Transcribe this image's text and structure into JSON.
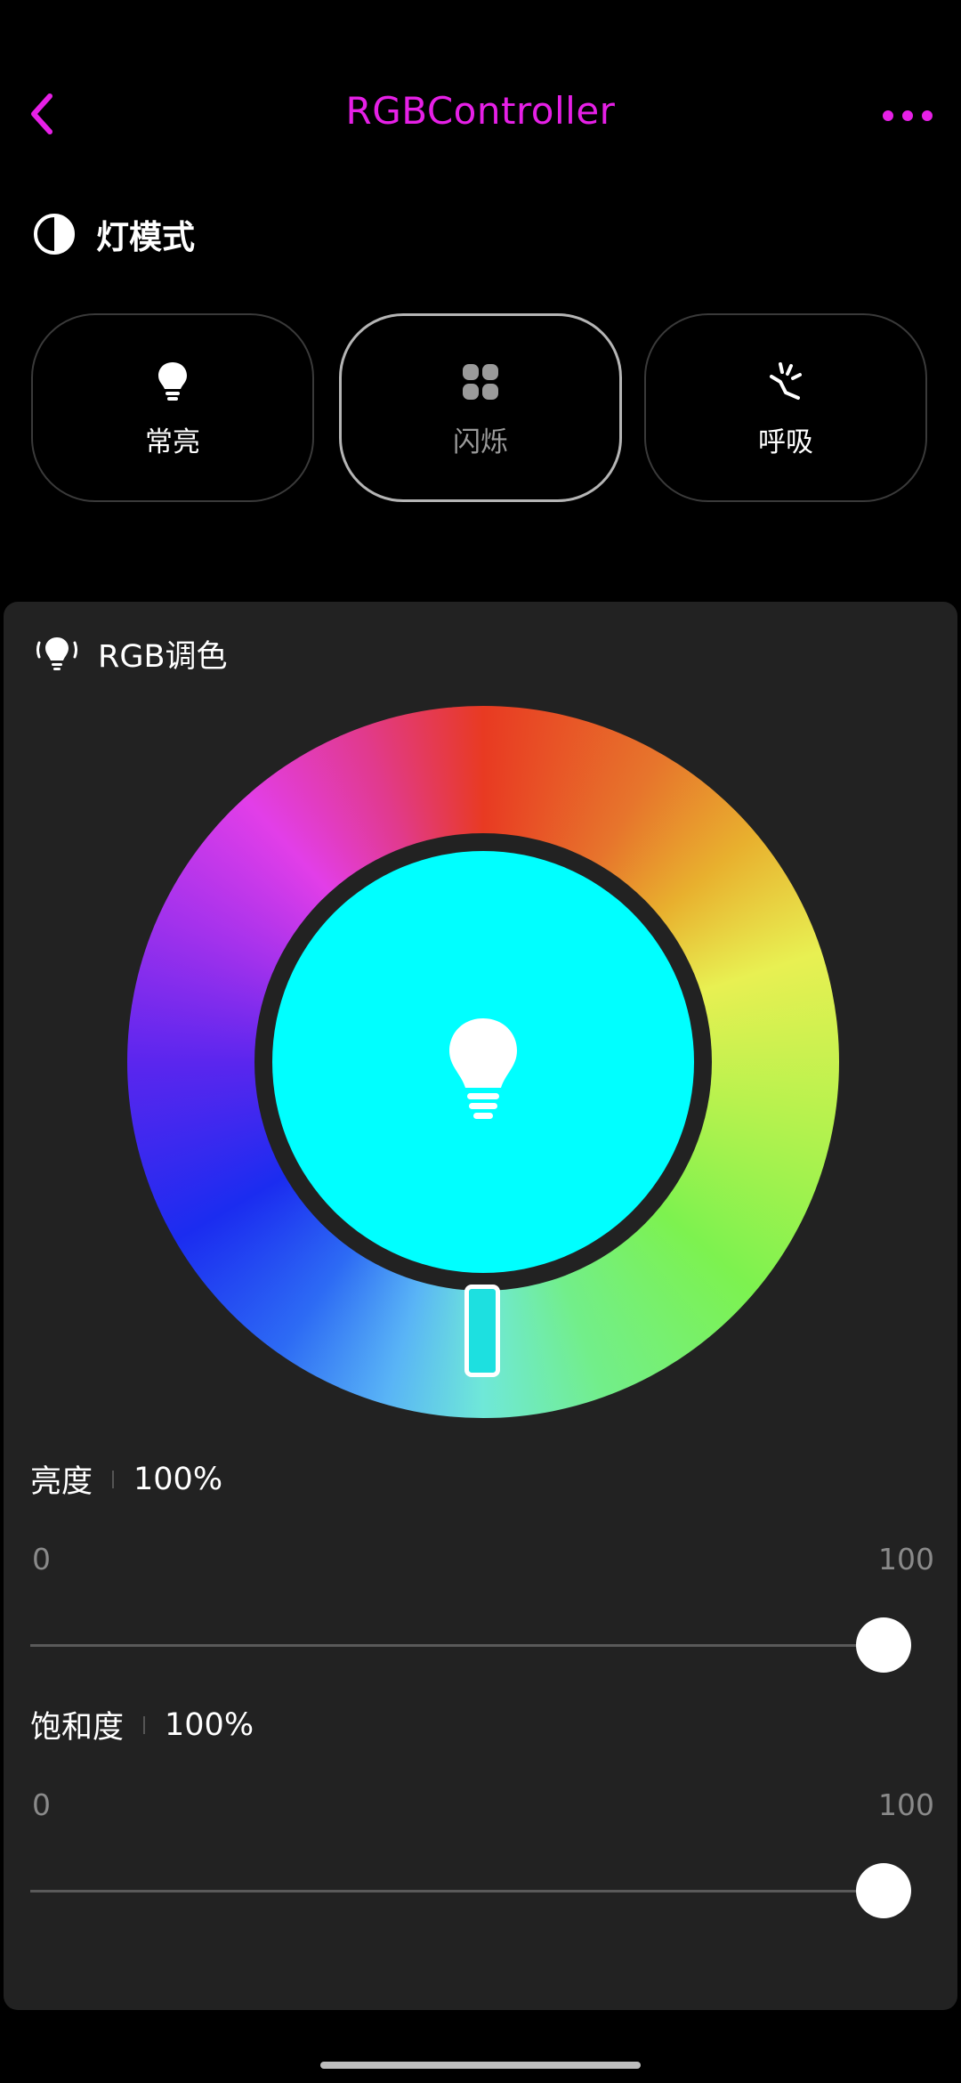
{
  "header": {
    "title": "RGBController",
    "accent_color": "#e620e6"
  },
  "light_mode": {
    "section_title": "灯模式",
    "section_icon": "half-circle-contrast-icon",
    "modes": [
      {
        "label": "常亮",
        "icon": "lightbulb-icon",
        "selected": false
      },
      {
        "label": "闪烁",
        "icon": "four-dots-grid-icon",
        "selected": true
      },
      {
        "label": "呼吸",
        "icon": "breathing-rays-icon",
        "selected": false
      }
    ]
  },
  "rgb": {
    "section_title": "RGB调色",
    "section_icon": "lightbulb-glow-icon",
    "selected_color": "#00ffff",
    "center_icon": "lightbulb-icon"
  },
  "brightness": {
    "label": "亮度",
    "value_text": "100%",
    "min": "0",
    "max": "100",
    "value": 100
  },
  "saturation": {
    "label": "饱和度",
    "value_text": "100%",
    "min": "0",
    "max": "100",
    "value": 100
  }
}
